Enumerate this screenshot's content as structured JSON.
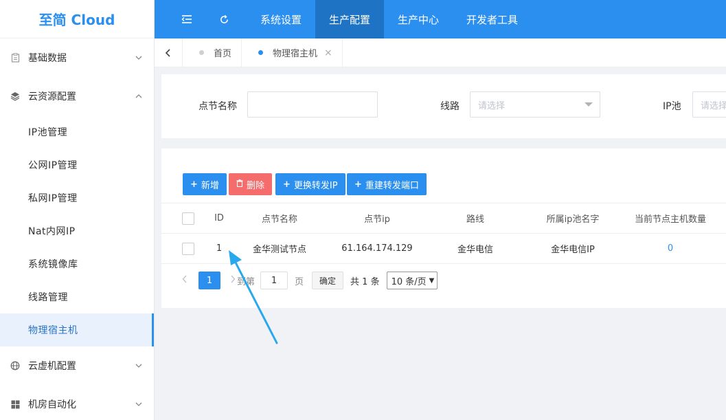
{
  "sidebar": {
    "logo": "至简 Cloud",
    "groups": [
      {
        "label": "基础数据",
        "icon": "clipboard-icon"
      },
      {
        "label": "云资源配置",
        "icon": "layers-icon"
      },
      {
        "label": "云虚机配置",
        "icon": "globe-icon"
      },
      {
        "label": "机房自动化",
        "icon": "windows-icon"
      }
    ],
    "sub_items": [
      {
        "label": "IP池管理"
      },
      {
        "label": "公网IP管理"
      },
      {
        "label": "私网IP管理"
      },
      {
        "label": "Nat内网IP"
      },
      {
        "label": "系统镜像库"
      },
      {
        "label": "线路管理"
      },
      {
        "label": "物理宿主机",
        "active": true
      }
    ]
  },
  "topbar": {
    "nav": [
      {
        "label": "系统设置"
      },
      {
        "label": "生产配置",
        "active": true
      },
      {
        "label": "生产中心"
      },
      {
        "label": "开发者工具"
      }
    ]
  },
  "tabs": [
    {
      "label": "首页"
    },
    {
      "label": "物理宿主机",
      "active": true,
      "close": "×"
    }
  ],
  "search": {
    "node_name_label": "点节名称",
    "node_name_value": "",
    "route_label": "线路",
    "route_placeholder": "请选择",
    "ip_pool_label": "IP池",
    "ip_pool_placeholder": "请选择"
  },
  "toolbar": {
    "add": "新增",
    "delete": "删除",
    "change_ip": "更换转发IP",
    "rebuild_port": "重建转发端口"
  },
  "table": {
    "columns": [
      "ID",
      "点节名称",
      "点节ip",
      "路线",
      "所属ip池名字",
      "当前节点主机数量"
    ],
    "rows": [
      {
        "id": "1",
        "name": "金华测试节点",
        "ip": "61.164.174.129",
        "route": "金华电信",
        "pool": "金华电信IP",
        "count": "0"
      }
    ]
  },
  "pager": {
    "current": "1",
    "goto_label": "到第",
    "goto_value": "1",
    "page_unit": "页",
    "confirm": "确定",
    "total": "共 1 条",
    "page_size": "10 条/页"
  },
  "colors": {
    "primary": "#2b8ff0",
    "danger": "#f56c6c",
    "annotation_arrow": "#29a8ee"
  }
}
